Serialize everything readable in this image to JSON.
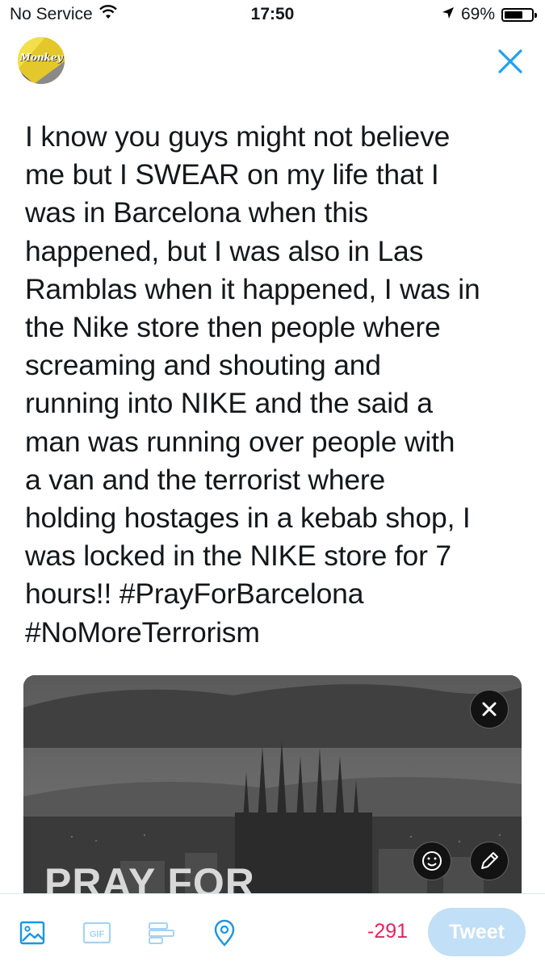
{
  "status": {
    "carrier": "No Service",
    "time": "17:50",
    "battery": "69%",
    "battery_level": 0.69
  },
  "header": {
    "avatar_text": "Monkey"
  },
  "composer": {
    "text": "I know you guys might not believe me but I SWEAR on my life that I was in Barcelona when this happened, but I was also in Las Ramblas when it happened, I was in the Nike store then people where screaming and shouting and running into NIKE and the said a man was running over people with a van and the terrorist where holding hostages in a kebab shop, I was locked in the NIKE store for 7 hours!! #PrayForBarcelona #NoMoreTerrorism",
    "lines": [
      "I know you guys might not believe",
      "me but I SWEAR on my life that I",
      "was in Barcelona when this",
      "happened, but I was also in Las",
      "Ramblas when it happened, I was in",
      "the Nike store then people where",
      "screaming and shouting and",
      "running into NIKE and the said a",
      "man was running over people with",
      "a van and the terrorist where",
      "holding hostages in a kebab shop, I",
      "was locked in the NIKE store for 7",
      "hours!! #PrayForBarcelona",
      "#NoMoreTerrorism"
    ]
  },
  "media": {
    "caption": "PRAY FOR"
  },
  "toolbar": {
    "gif_label": "GIF",
    "char_count": "-291",
    "tweet_label": "Tweet"
  },
  "colors": {
    "accent": "#1da1f2",
    "icon_blue": "#1b95e0",
    "tweet_button_disabled": "#c1dff6",
    "error": "#e0245e",
    "text": "#14171a"
  },
  "icons": {
    "status": [
      "wifi-icon",
      "location-arrow-icon",
      "battery-icon"
    ],
    "header": [
      "close-icon"
    ],
    "media": [
      "remove-media-icon",
      "emoji-sticker-icon",
      "edit-pencil-icon"
    ],
    "toolbar": [
      "photo-icon",
      "gif-icon",
      "poll-icon",
      "location-pin-icon"
    ]
  }
}
